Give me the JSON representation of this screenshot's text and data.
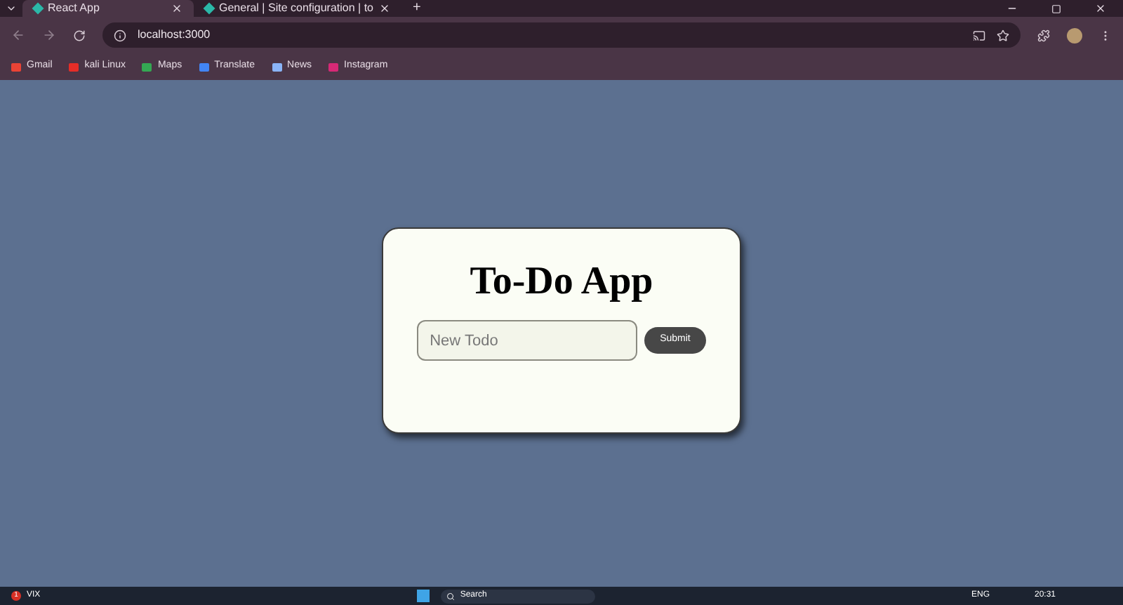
{
  "browser": {
    "tabs": [
      {
        "title": "React App",
        "selected": true
      },
      {
        "title": "General | Site configuration | to",
        "selected": false
      }
    ],
    "new_tab": "+",
    "url": "localhost:3000",
    "bookmarks": [
      {
        "label": "Gmail",
        "color": "#ea4335"
      },
      {
        "label": "kali Linux",
        "color": "#e52d27"
      },
      {
        "label": "Maps",
        "color": "#34a853"
      },
      {
        "label": "Translate",
        "color": "#4285f4"
      },
      {
        "label": "News",
        "color": "#8ab4f8"
      },
      {
        "label": "Instagram",
        "color": "#d62976"
      }
    ]
  },
  "app": {
    "title": "To-Do App",
    "input": {
      "placeholder": "New Todo"
    },
    "submit": "Submit"
  },
  "taskbar": {
    "weather_badge": "1",
    "weather_label": "VIX",
    "search": "Search",
    "language": "ENG",
    "time": "20:31"
  }
}
